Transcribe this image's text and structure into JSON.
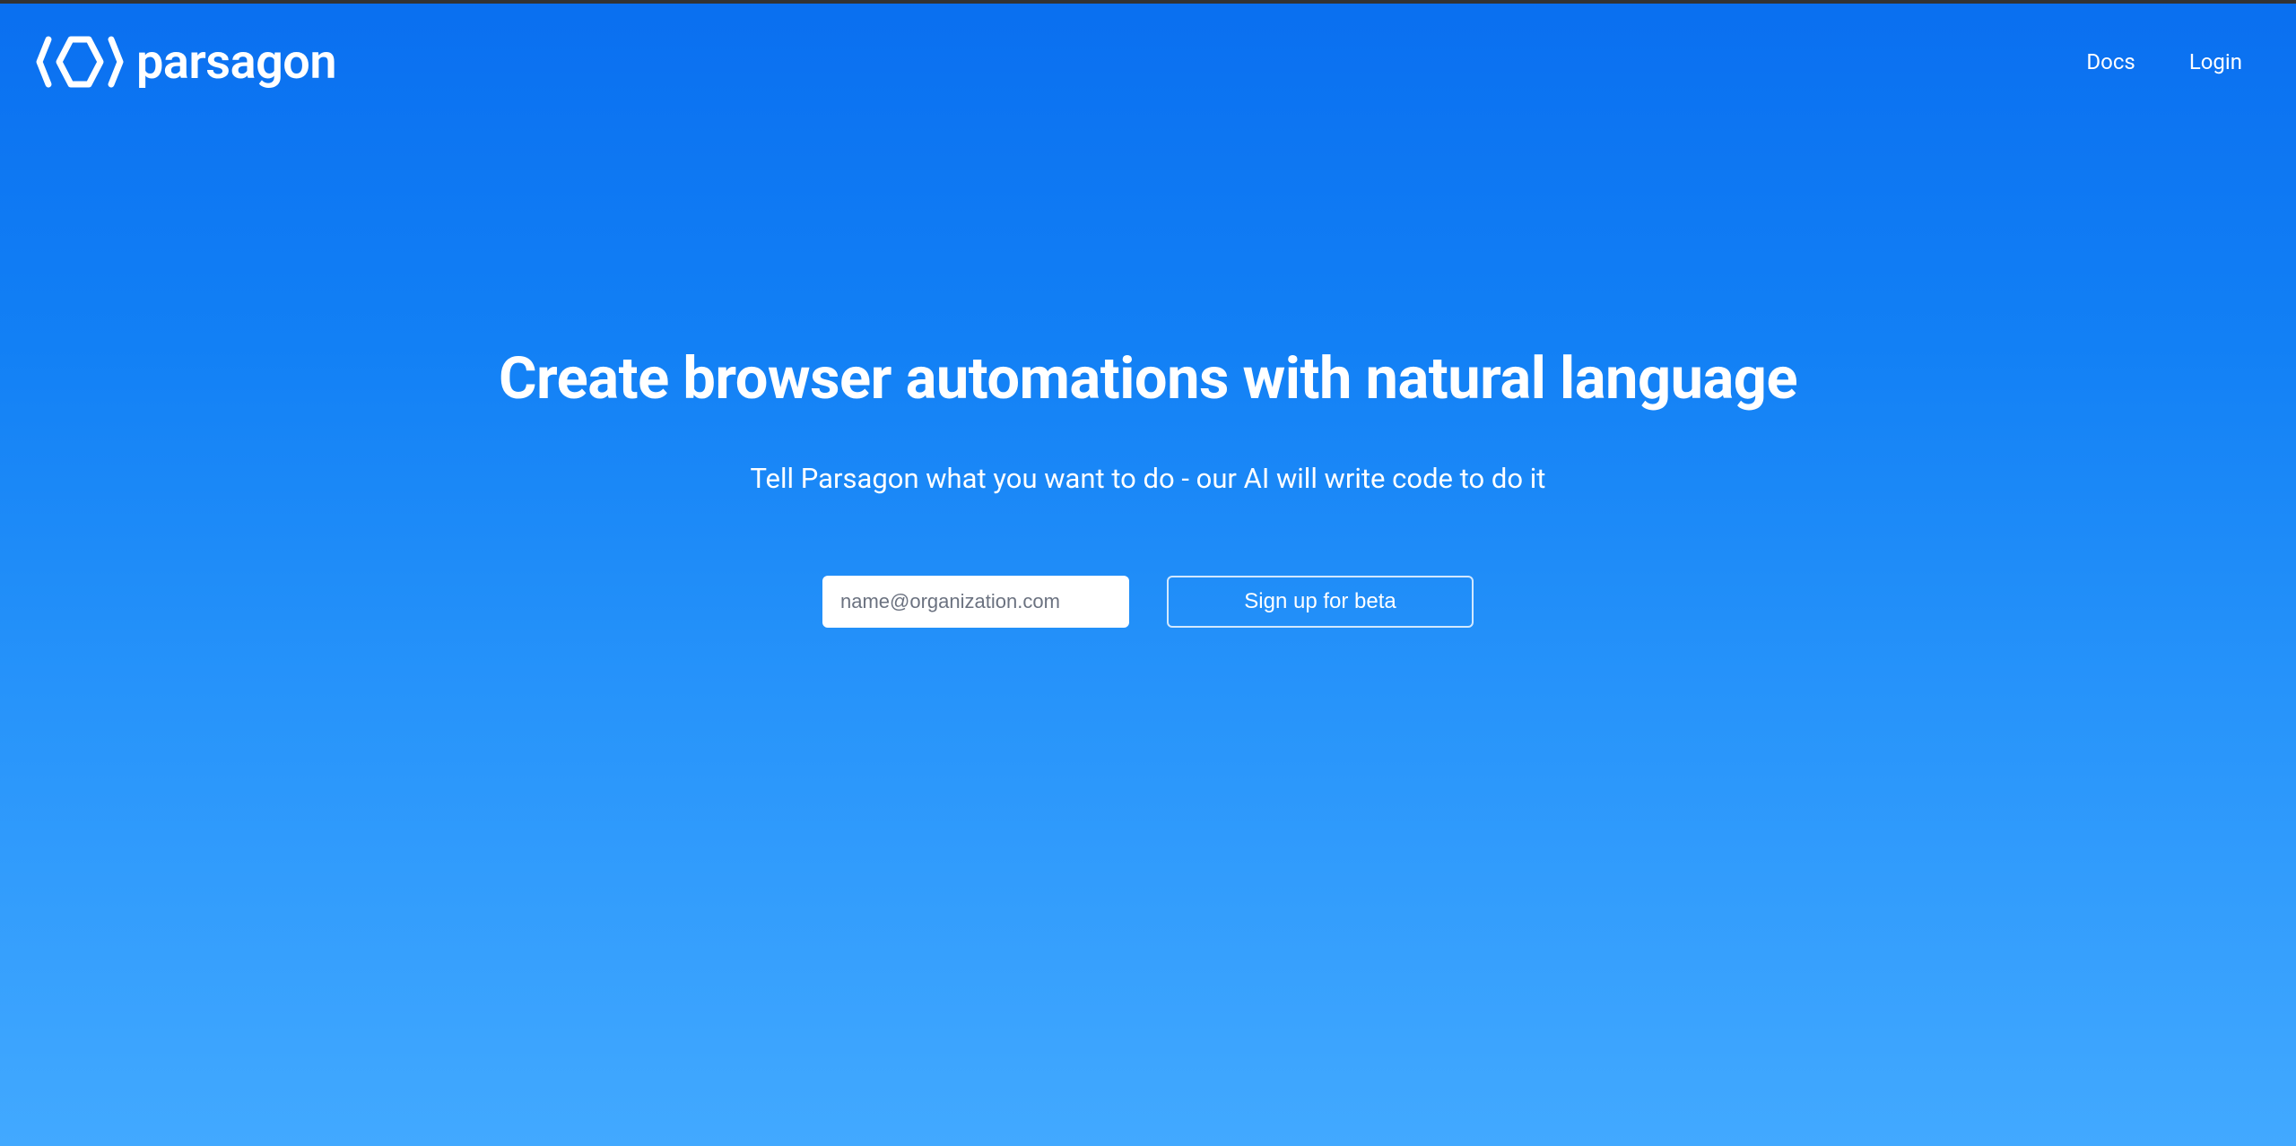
{
  "brand": {
    "name": "parsagon"
  },
  "nav": {
    "docs": "Docs",
    "login": "Login"
  },
  "hero": {
    "title": "Create browser automations with natural language",
    "subtitle": "Tell Parsagon what you want to do - our AI will write code to do it"
  },
  "form": {
    "email_placeholder": "name@organization.com",
    "signup_button": "Sign up for beta"
  }
}
